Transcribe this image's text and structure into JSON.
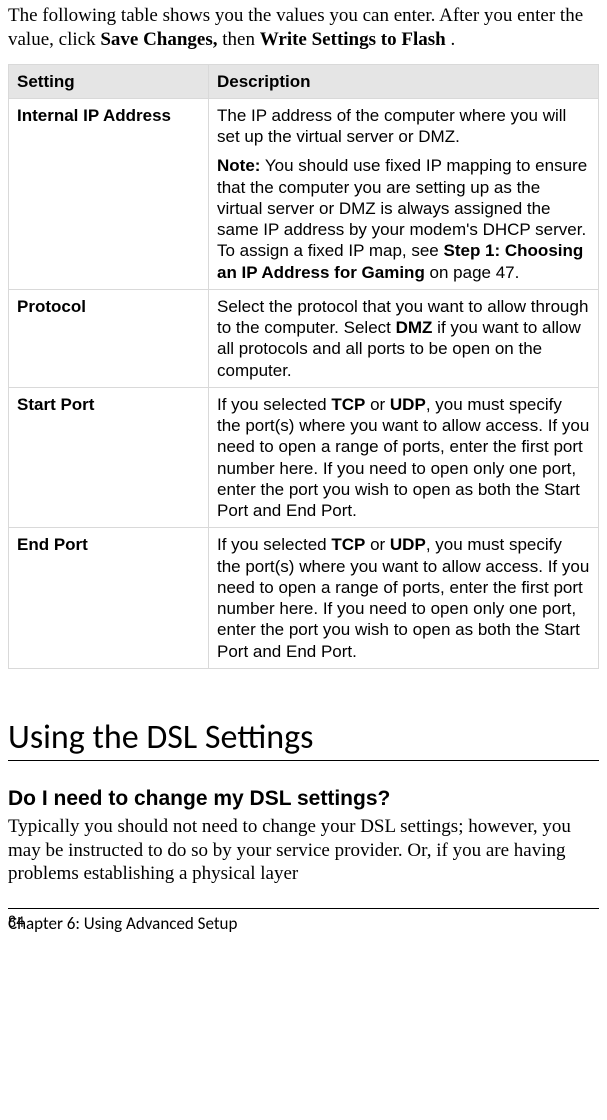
{
  "intro": {
    "line1": "The following table shows you the values you can enter. After you enter the value, click ",
    "bold1": "Save Changes,",
    "mid": " then ",
    "bold2": "Write Settings to Flash",
    "end": "."
  },
  "table": {
    "headers": {
      "setting": "Setting",
      "description": "Description"
    },
    "rows": [
      {
        "setting": "Internal IP Address",
        "p1": "The IP address of the computer where you will set up the virtual server or DMZ.",
        "note_label": "Note:",
        "note_a": " You should use fixed IP mapping to ensure that the computer you are setting up as the virtual server or DMZ is always assigned the same IP address by your modem's DHCP server. To assign a fixed IP map, see ",
        "note_bold": "Step 1: Choosing an IP Address for Gaming",
        "note_b": " on page 47."
      },
      {
        "setting": "Protocol",
        "p1a": "Select the protocol that you want to allow through to the computer. Select ",
        "p1bold": "DMZ",
        "p1b": " if you want to allow all protocols and all ports to be open on the computer."
      },
      {
        "setting": "Start Port",
        "p1a": "If you selected ",
        "tcp": "TCP",
        "or": " or ",
        "udp": "UDP",
        "p1b": ", you must specify the port(s) where you want to allow access. If you need to open a range of ports, enter the first port number here. If you need to open only one port, enter the port you wish to open as both the Start Port and End Port."
      },
      {
        "setting": "End Port",
        "p1a": "If you selected ",
        "tcp": "TCP",
        "or": " or ",
        "udp": "UDP",
        "p1b": ", you must specify the port(s) where you want to allow access. If you need to open a range of ports, enter the first port number here. If you need to open only one port, enter the port you wish to open as both the Start Port and End Port."
      }
    ]
  },
  "section_heading": "Using the DSL Settings",
  "subheading": "Do I need to change my DSL settings?",
  "body": "Typically you should not need to change your DSL settings; however, you may be instructed to do so by your service provider. Or, if you are having problems establishing a physical layer",
  "footer": {
    "page": "84",
    "chapter": "Chapter 6: Using Advanced Setup"
  }
}
